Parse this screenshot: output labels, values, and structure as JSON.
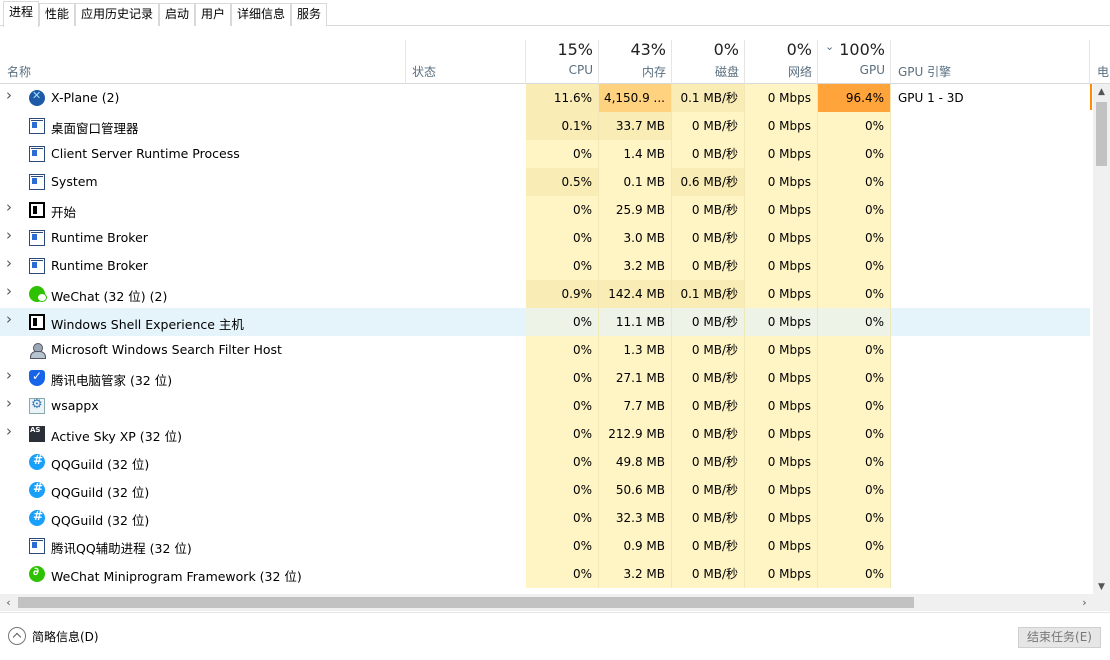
{
  "tabs": [
    "进程",
    "性能",
    "应用历史记录",
    "启动",
    "用户",
    "详细信息",
    "服务"
  ],
  "header": {
    "name_label": "名称",
    "status_label": "状态",
    "cpu": {
      "pct": "15%",
      "label": "CPU"
    },
    "mem": {
      "pct": "43%",
      "label": "内存"
    },
    "disk": {
      "pct": "0%",
      "label": "磁盘"
    },
    "net": {
      "pct": "0%",
      "label": "网络"
    },
    "gpu": {
      "pct": "100%",
      "label": "GPU"
    },
    "gpu_engine_label": "GPU 引擎",
    "power_label_partial": "电"
  },
  "colors": {
    "heat_light": "#fff4c4",
    "heat_mid": "#f9ecb5",
    "heat_strong": "#ffd27f",
    "heat_max": "#ffa43a",
    "hover": "#e5f3fb"
  },
  "processes": [
    {
      "name": "X-Plane (2)",
      "icon": "xplane-icon",
      "expandable": true,
      "cpu": "11.6%",
      "mem": "4,150.9 ...",
      "disk": "0.1 MB/秒",
      "net": "0 Mbps",
      "gpu": "96.4%",
      "engine": "GPU 1 - 3D",
      "heat": {
        "cpu": "mid",
        "mem": "strong",
        "disk": "mid",
        "net": "light",
        "gpu": "max"
      }
    },
    {
      "name": "桌面窗口管理器",
      "icon": "window-app-icon",
      "expandable": false,
      "cpu": "0.1%",
      "mem": "33.7 MB",
      "disk": "0 MB/秒",
      "net": "0 Mbps",
      "gpu": "0%",
      "engine": "",
      "heat": {
        "cpu": "mid",
        "mem": "mid",
        "disk": "light",
        "net": "light",
        "gpu": "light"
      }
    },
    {
      "name": "Client Server Runtime Process",
      "icon": "window-app-icon",
      "expandable": false,
      "cpu": "0%",
      "mem": "1.4 MB",
      "disk": "0 MB/秒",
      "net": "0 Mbps",
      "gpu": "0%",
      "engine": "",
      "heat": {
        "cpu": "light",
        "mem": "light",
        "disk": "light",
        "net": "light",
        "gpu": "light"
      }
    },
    {
      "name": "System",
      "icon": "window-app-icon",
      "expandable": false,
      "cpu": "0.5%",
      "mem": "0.1 MB",
      "disk": "0.6 MB/秒",
      "net": "0 Mbps",
      "gpu": "0%",
      "engine": "",
      "heat": {
        "cpu": "mid",
        "mem": "light",
        "disk": "mid",
        "net": "light",
        "gpu": "light"
      }
    },
    {
      "name": "开始",
      "icon": "start-window-icon",
      "expandable": true,
      "cpu": "0%",
      "mem": "25.9 MB",
      "disk": "0 MB/秒",
      "net": "0 Mbps",
      "gpu": "0%",
      "engine": "",
      "heat": {
        "cpu": "light",
        "mem": "light",
        "disk": "light",
        "net": "light",
        "gpu": "light"
      }
    },
    {
      "name": "Runtime Broker",
      "icon": "window-app-icon",
      "expandable": true,
      "cpu": "0%",
      "mem": "3.0 MB",
      "disk": "0 MB/秒",
      "net": "0 Mbps",
      "gpu": "0%",
      "engine": "",
      "heat": {
        "cpu": "light",
        "mem": "light",
        "disk": "light",
        "net": "light",
        "gpu": "light"
      }
    },
    {
      "name": "Runtime Broker",
      "icon": "window-app-icon",
      "expandable": true,
      "cpu": "0%",
      "mem": "3.2 MB",
      "disk": "0 MB/秒",
      "net": "0 Mbps",
      "gpu": "0%",
      "engine": "",
      "heat": {
        "cpu": "light",
        "mem": "light",
        "disk": "light",
        "net": "light",
        "gpu": "light"
      }
    },
    {
      "name": "WeChat (32 位) (2)",
      "icon": "wechat-icon",
      "expandable": true,
      "cpu": "0.9%",
      "mem": "142.4 MB",
      "disk": "0.1 MB/秒",
      "net": "0 Mbps",
      "gpu": "0%",
      "engine": "",
      "heat": {
        "cpu": "mid",
        "mem": "mid",
        "disk": "mid",
        "net": "light",
        "gpu": "light"
      }
    },
    {
      "name": "Windows Shell Experience 主机",
      "icon": "start-window-icon",
      "expandable": true,
      "cpu": "0%",
      "mem": "11.1 MB",
      "disk": "0 MB/秒",
      "net": "0 Mbps",
      "gpu": "0%",
      "engine": "",
      "hover": true,
      "heat": {
        "cpu": "light",
        "mem": "light",
        "disk": "light",
        "net": "light",
        "gpu": "light"
      }
    },
    {
      "name": "Microsoft Windows Search Filter Host",
      "icon": "search-user-icon",
      "expandable": false,
      "cpu": "0%",
      "mem": "1.3 MB",
      "disk": "0 MB/秒",
      "net": "0 Mbps",
      "gpu": "0%",
      "engine": "",
      "heat": {
        "cpu": "light",
        "mem": "light",
        "disk": "light",
        "net": "light",
        "gpu": "light"
      }
    },
    {
      "name": "腾讯电脑管家 (32 位)",
      "icon": "tencent-pc-manager-icon",
      "expandable": true,
      "cpu": "0%",
      "mem": "27.1 MB",
      "disk": "0 MB/秒",
      "net": "0 Mbps",
      "gpu": "0%",
      "engine": "",
      "heat": {
        "cpu": "light",
        "mem": "light",
        "disk": "light",
        "net": "light",
        "gpu": "light"
      }
    },
    {
      "name": "wsappx",
      "icon": "gear-icon",
      "expandable": true,
      "cpu": "0%",
      "mem": "7.7 MB",
      "disk": "0 MB/秒",
      "net": "0 Mbps",
      "gpu": "0%",
      "engine": "",
      "heat": {
        "cpu": "light",
        "mem": "light",
        "disk": "light",
        "net": "light",
        "gpu": "light"
      }
    },
    {
      "name": "Active Sky XP (32 位)",
      "icon": "active-sky-icon",
      "expandable": true,
      "cpu": "0%",
      "mem": "212.9 MB",
      "disk": "0 MB/秒",
      "net": "0 Mbps",
      "gpu": "0%",
      "engine": "",
      "heat": {
        "cpu": "light",
        "mem": "light",
        "disk": "light",
        "net": "light",
        "gpu": "light"
      }
    },
    {
      "name": "QQGuild (32 位)",
      "icon": "qqguild-icon",
      "expandable": false,
      "cpu": "0%",
      "mem": "49.8 MB",
      "disk": "0 MB/秒",
      "net": "0 Mbps",
      "gpu": "0%",
      "engine": "",
      "heat": {
        "cpu": "light",
        "mem": "light",
        "disk": "light",
        "net": "light",
        "gpu": "light"
      }
    },
    {
      "name": "QQGuild (32 位)",
      "icon": "qqguild-icon",
      "expandable": false,
      "cpu": "0%",
      "mem": "50.6 MB",
      "disk": "0 MB/秒",
      "net": "0 Mbps",
      "gpu": "0%",
      "engine": "",
      "heat": {
        "cpu": "light",
        "mem": "light",
        "disk": "light",
        "net": "light",
        "gpu": "light"
      }
    },
    {
      "name": "QQGuild (32 位)",
      "icon": "qqguild-icon",
      "expandable": false,
      "cpu": "0%",
      "mem": "32.3 MB",
      "disk": "0 MB/秒",
      "net": "0 Mbps",
      "gpu": "0%",
      "engine": "",
      "heat": {
        "cpu": "light",
        "mem": "light",
        "disk": "light",
        "net": "light",
        "gpu": "light"
      }
    },
    {
      "name": "腾讯QQ辅助进程 (32 位)",
      "icon": "window-app-icon",
      "expandable": false,
      "cpu": "0%",
      "mem": "0.9 MB",
      "disk": "0 MB/秒",
      "net": "0 Mbps",
      "gpu": "0%",
      "engine": "",
      "heat": {
        "cpu": "light",
        "mem": "light",
        "disk": "light",
        "net": "light",
        "gpu": "light"
      }
    },
    {
      "name": "WeChat Miniprogram Framework (32 位)",
      "icon": "wechat-miniprogram-icon",
      "expandable": false,
      "cpu": "0%",
      "mem": "3.2 MB",
      "disk": "0 MB/秒",
      "net": "0 Mbps",
      "gpu": "0%",
      "engine": "",
      "heat": {
        "cpu": "light",
        "mem": "light",
        "disk": "light",
        "net": "light",
        "gpu": "light"
      }
    }
  ],
  "footer": {
    "fewer_details": "简略信息(D)",
    "end_task": "结束任务(E)"
  }
}
